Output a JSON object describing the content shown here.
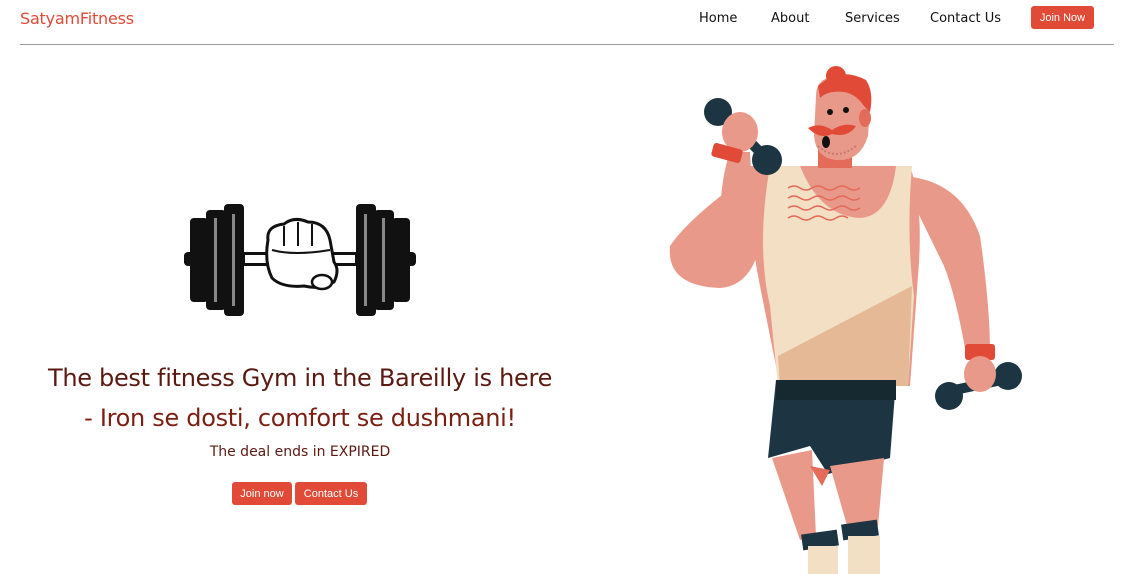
{
  "brand": "SatyamFitness",
  "nav": {
    "links": [
      "Home",
      "About",
      "Services",
      "Contact Us"
    ],
    "cta": "Join Now"
  },
  "hero": {
    "headline": "The best fitness Gym in the Bareilly is here",
    "tagline": "- Iron se dosti, comfort se dushmani!",
    "deal": "The deal ends in EXPIRED",
    "buttons": {
      "join": "Join now",
      "contact": "Contact Us"
    }
  },
  "colors": {
    "accent": "#e04a37",
    "heading": "#5a1a12"
  },
  "images": {
    "logo": "dumbbell-fist-icon",
    "illustration": "muscleman-with-dumbbells"
  }
}
